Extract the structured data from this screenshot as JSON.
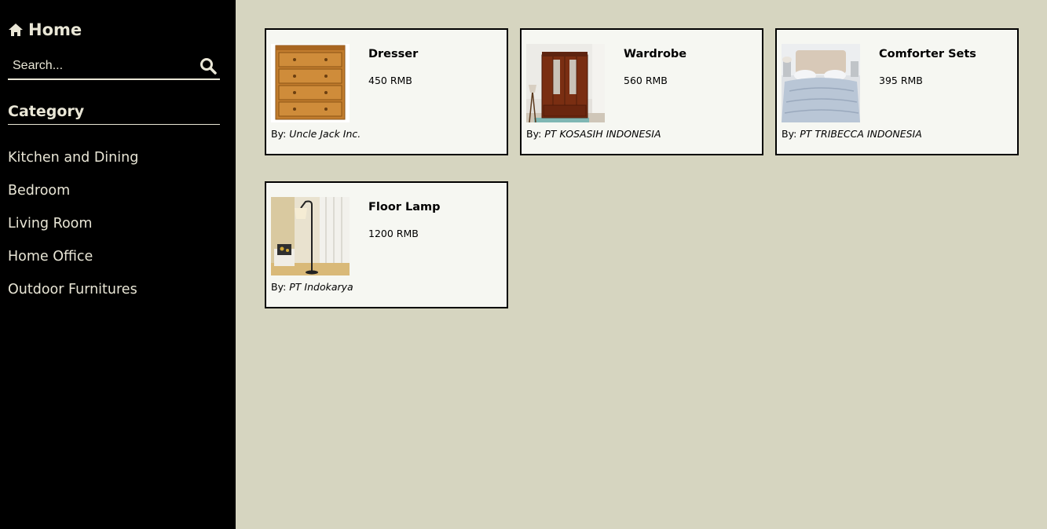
{
  "sidebar": {
    "home_label": "Home",
    "home_icon": "home-icon",
    "search": {
      "placeholder": "Search...",
      "value": "",
      "icon": "search-icon"
    },
    "category_title": "Category",
    "categories": [
      {
        "label": "Kitchen and Dining"
      },
      {
        "label": "Bedroom"
      },
      {
        "label": "Living Room"
      },
      {
        "label": "Home Office"
      },
      {
        "label": "Outdoor Furnitures"
      }
    ]
  },
  "by_label": "By:",
  "products": [
    {
      "name": "Dresser",
      "price": "450 RMB",
      "seller": "Uncle Jack Inc."
    },
    {
      "name": "Wardrobe",
      "price": "560 RMB",
      "seller": "PT KOSASIH INDONESIA"
    },
    {
      "name": "Comforter Sets",
      "price": "395 RMB",
      "seller": "PT TRIBECCA INDONESIA"
    },
    {
      "name": "Floor Lamp",
      "price": "1200 RMB",
      "seller": "PT Indokarya"
    }
  ],
  "colors": {
    "sidebar_bg": "#000000",
    "sidebar_text": "#e9e6d6",
    "main_bg": "#d6d5c0",
    "card_bg": "#f6f7f2"
  }
}
